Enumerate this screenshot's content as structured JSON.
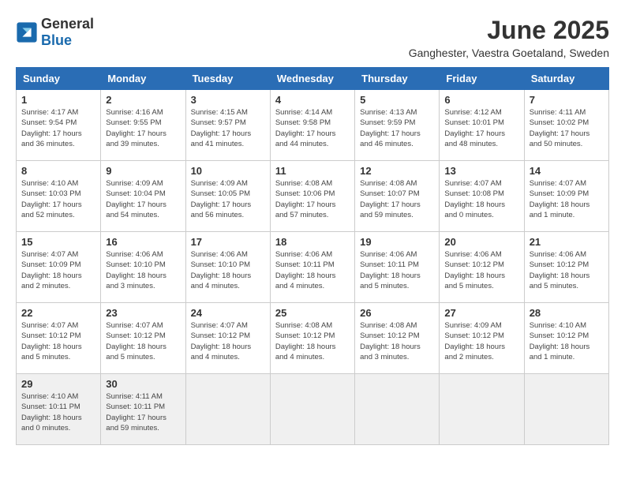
{
  "header": {
    "logo_general": "General",
    "logo_blue": "Blue",
    "title": "June 2025",
    "subtitle": "Ganghester, Vaestra Goetaland, Sweden"
  },
  "weekdays": [
    "Sunday",
    "Monday",
    "Tuesday",
    "Wednesday",
    "Thursday",
    "Friday",
    "Saturday"
  ],
  "weeks": [
    [
      {
        "day": "1",
        "info": "Sunrise: 4:17 AM\nSunset: 9:54 PM\nDaylight: 17 hours\nand 36 minutes."
      },
      {
        "day": "2",
        "info": "Sunrise: 4:16 AM\nSunset: 9:55 PM\nDaylight: 17 hours\nand 39 minutes."
      },
      {
        "day": "3",
        "info": "Sunrise: 4:15 AM\nSunset: 9:57 PM\nDaylight: 17 hours\nand 41 minutes."
      },
      {
        "day": "4",
        "info": "Sunrise: 4:14 AM\nSunset: 9:58 PM\nDaylight: 17 hours\nand 44 minutes."
      },
      {
        "day": "5",
        "info": "Sunrise: 4:13 AM\nSunset: 9:59 PM\nDaylight: 17 hours\nand 46 minutes."
      },
      {
        "day": "6",
        "info": "Sunrise: 4:12 AM\nSunset: 10:01 PM\nDaylight: 17 hours\nand 48 minutes."
      },
      {
        "day": "7",
        "info": "Sunrise: 4:11 AM\nSunset: 10:02 PM\nDaylight: 17 hours\nand 50 minutes."
      }
    ],
    [
      {
        "day": "8",
        "info": "Sunrise: 4:10 AM\nSunset: 10:03 PM\nDaylight: 17 hours\nand 52 minutes."
      },
      {
        "day": "9",
        "info": "Sunrise: 4:09 AM\nSunset: 10:04 PM\nDaylight: 17 hours\nand 54 minutes."
      },
      {
        "day": "10",
        "info": "Sunrise: 4:09 AM\nSunset: 10:05 PM\nDaylight: 17 hours\nand 56 minutes."
      },
      {
        "day": "11",
        "info": "Sunrise: 4:08 AM\nSunset: 10:06 PM\nDaylight: 17 hours\nand 57 minutes."
      },
      {
        "day": "12",
        "info": "Sunrise: 4:08 AM\nSunset: 10:07 PM\nDaylight: 17 hours\nand 59 minutes."
      },
      {
        "day": "13",
        "info": "Sunrise: 4:07 AM\nSunset: 10:08 PM\nDaylight: 18 hours\nand 0 minutes."
      },
      {
        "day": "14",
        "info": "Sunrise: 4:07 AM\nSunset: 10:09 PM\nDaylight: 18 hours\nand 1 minute."
      }
    ],
    [
      {
        "day": "15",
        "info": "Sunrise: 4:07 AM\nSunset: 10:09 PM\nDaylight: 18 hours\nand 2 minutes."
      },
      {
        "day": "16",
        "info": "Sunrise: 4:06 AM\nSunset: 10:10 PM\nDaylight: 18 hours\nand 3 minutes."
      },
      {
        "day": "17",
        "info": "Sunrise: 4:06 AM\nSunset: 10:10 PM\nDaylight: 18 hours\nand 4 minutes."
      },
      {
        "day": "18",
        "info": "Sunrise: 4:06 AM\nSunset: 10:11 PM\nDaylight: 18 hours\nand 4 minutes."
      },
      {
        "day": "19",
        "info": "Sunrise: 4:06 AM\nSunset: 10:11 PM\nDaylight: 18 hours\nand 5 minutes."
      },
      {
        "day": "20",
        "info": "Sunrise: 4:06 AM\nSunset: 10:12 PM\nDaylight: 18 hours\nand 5 minutes."
      },
      {
        "day": "21",
        "info": "Sunrise: 4:06 AM\nSunset: 10:12 PM\nDaylight: 18 hours\nand 5 minutes."
      }
    ],
    [
      {
        "day": "22",
        "info": "Sunrise: 4:07 AM\nSunset: 10:12 PM\nDaylight: 18 hours\nand 5 minutes."
      },
      {
        "day": "23",
        "info": "Sunrise: 4:07 AM\nSunset: 10:12 PM\nDaylight: 18 hours\nand 5 minutes."
      },
      {
        "day": "24",
        "info": "Sunrise: 4:07 AM\nSunset: 10:12 PM\nDaylight: 18 hours\nand 4 minutes."
      },
      {
        "day": "25",
        "info": "Sunrise: 4:08 AM\nSunset: 10:12 PM\nDaylight: 18 hours\nand 4 minutes."
      },
      {
        "day": "26",
        "info": "Sunrise: 4:08 AM\nSunset: 10:12 PM\nDaylight: 18 hours\nand 3 minutes."
      },
      {
        "day": "27",
        "info": "Sunrise: 4:09 AM\nSunset: 10:12 PM\nDaylight: 18 hours\nand 2 minutes."
      },
      {
        "day": "28",
        "info": "Sunrise: 4:10 AM\nSunset: 10:12 PM\nDaylight: 18 hours\nand 1 minute."
      }
    ],
    [
      {
        "day": "29",
        "info": "Sunrise: 4:10 AM\nSunset: 10:11 PM\nDaylight: 18 hours\nand 0 minutes."
      },
      {
        "day": "30",
        "info": "Sunrise: 4:11 AM\nSunset: 10:11 PM\nDaylight: 17 hours\nand 59 minutes."
      },
      null,
      null,
      null,
      null,
      null
    ]
  ]
}
